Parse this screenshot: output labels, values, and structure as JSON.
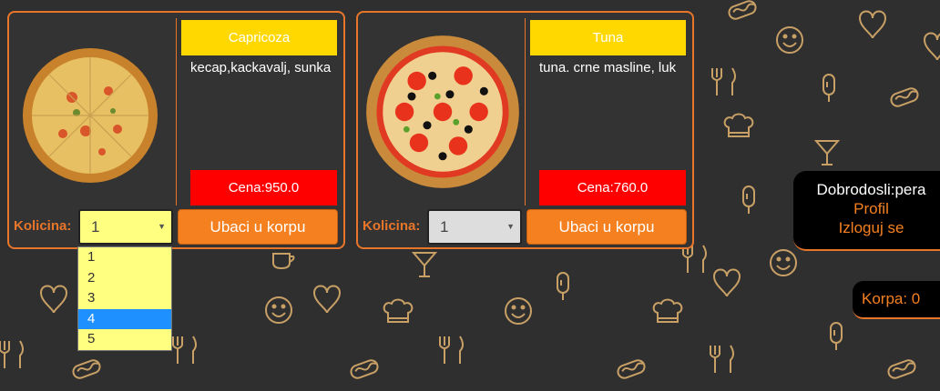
{
  "products": [
    {
      "title": "Capricoza",
      "description": "kecap,kackavalj, sunka",
      "price": "Cena:950.0",
      "quantity_label": "Kolicina:",
      "quantity_value": "1",
      "add_label": "Ubaci u korpu",
      "select_bg": "#ffff80"
    },
    {
      "title": "Tuna",
      "description": "tuna. crne masline, luk",
      "price": "Cena:760.0",
      "quantity_label": "Kolicina:",
      "quantity_value": "1",
      "add_label": "Ubaci u korpu",
      "select_bg": "#dddddd"
    }
  ],
  "quantity_dropdown": {
    "options": [
      "1",
      "2",
      "3",
      "4",
      "5"
    ],
    "highlighted": "4"
  },
  "user_panel": {
    "welcome": "Dobrodosli:pera",
    "profile": "Profil",
    "logout": "Izloguj se"
  },
  "cart": {
    "label": "Korpa: 0"
  },
  "colors": {
    "accent": "#f58020",
    "title_bg": "#ffd800",
    "price_bg": "#ff0000",
    "background": "#2f2f2f",
    "highlight": "#1e90ff"
  },
  "background_icons": [
    "heart-icon",
    "smiley-icon",
    "fork-icon",
    "knife-icon",
    "hotdog-icon",
    "popsicle-icon",
    "chef-hat-icon",
    "cocktail-icon",
    "cup-icon"
  ]
}
